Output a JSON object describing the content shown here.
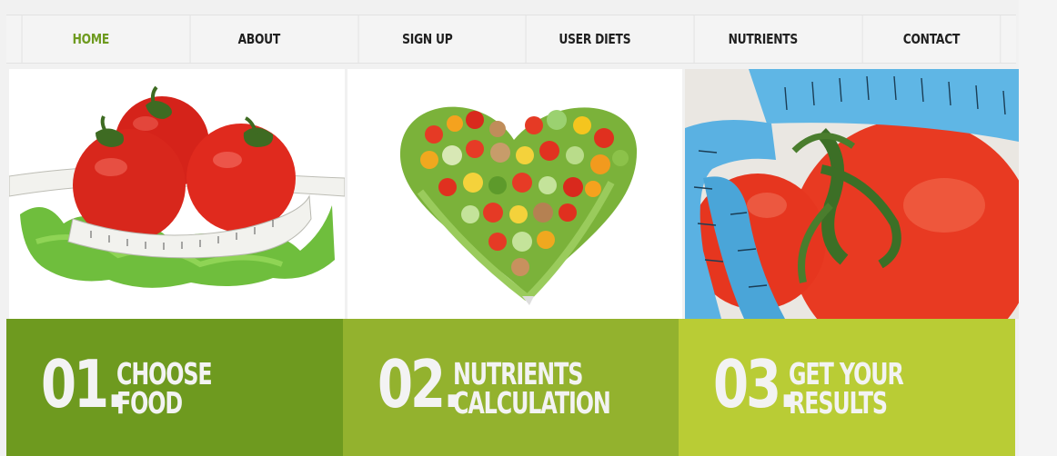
{
  "nav": {
    "items": [
      {
        "label": "HOME",
        "active": true
      },
      {
        "label": "ABOUT"
      },
      {
        "label": "SIGN UP"
      },
      {
        "label": "USER DIETS"
      },
      {
        "label": "NUTRIENTS"
      },
      {
        "label": "CONTACT"
      }
    ],
    "active_color": "#6e9a1f"
  },
  "images": [
    {
      "name": "tomatoes-measuring-tape"
    },
    {
      "name": "vegetable-heart"
    },
    {
      "name": "tomato-blue-measuring-tape"
    }
  ],
  "steps": [
    {
      "number": "01.",
      "line1": "CHOOSE",
      "line2": "FOOD",
      "color": "#6e9a1f"
    },
    {
      "number": "02.",
      "line1": "NUTRIENTS",
      "line2": "CALCULATION",
      "color": "#93b22e"
    },
    {
      "number": "03.",
      "line1": "GET YOUR",
      "line2": "RESULTS",
      "color": "#b9cc35"
    }
  ]
}
